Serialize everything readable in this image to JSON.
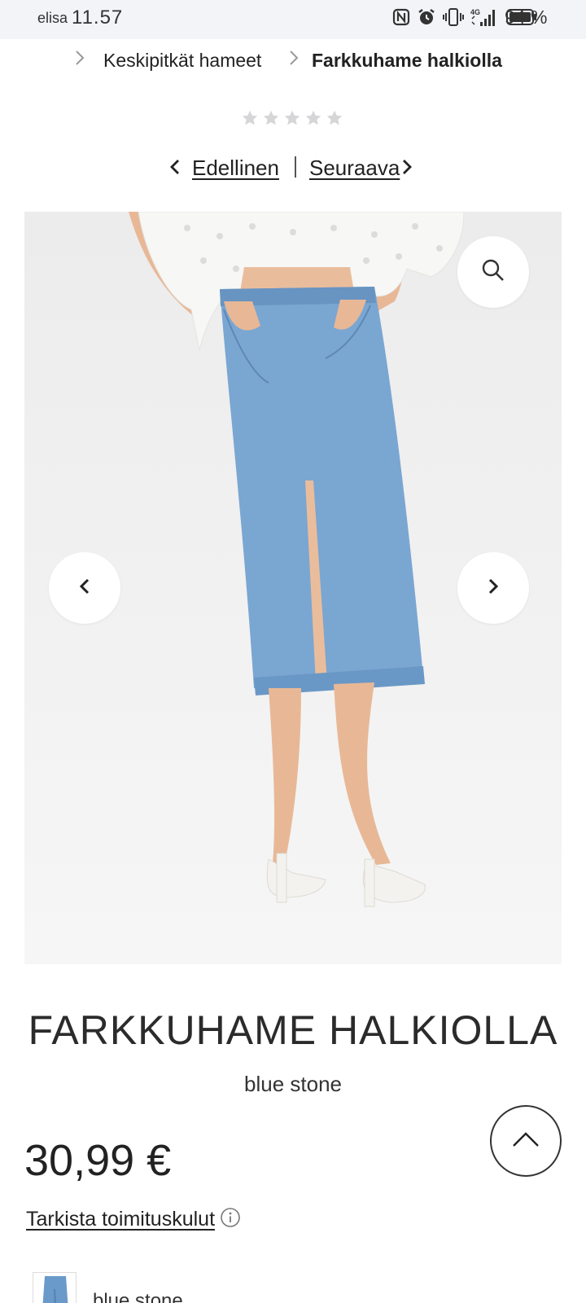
{
  "status_bar": {
    "carrier": "elisa",
    "time": "11.57",
    "battery": "94 %",
    "network": "4G",
    "icons": [
      "nfc-icon",
      "alarm-icon",
      "vibrate-icon",
      "signal-icon",
      "battery-icon"
    ]
  },
  "breadcrumb": {
    "items": [
      {
        "label": "Keskipitkät hameet"
      },
      {
        "label": "Farkkuhame halkiolla"
      }
    ]
  },
  "rating": {
    "stars": 5,
    "filled": 0,
    "star_color": "#d6d6d9"
  },
  "pager": {
    "previous": "Edellinen",
    "next": "Seuraava"
  },
  "gallery": {
    "zoom_icon": "search-icon",
    "prev_icon": "chevron-left-icon",
    "next_icon": "chevron-right-icon"
  },
  "product": {
    "title": "FARKKUHAME HALKIOLLA",
    "color": "blue stone",
    "price": "30,99 €",
    "shipping_link": "Tarkista toimituskulut"
  },
  "swatches": [
    {
      "label": "blue stone",
      "color": "#6a9ac9"
    }
  ],
  "colors": {
    "text": "#222222",
    "status_bg": "#f3f4f8",
    "image_bg": "#ededed",
    "denim": "#7aa6d2"
  }
}
